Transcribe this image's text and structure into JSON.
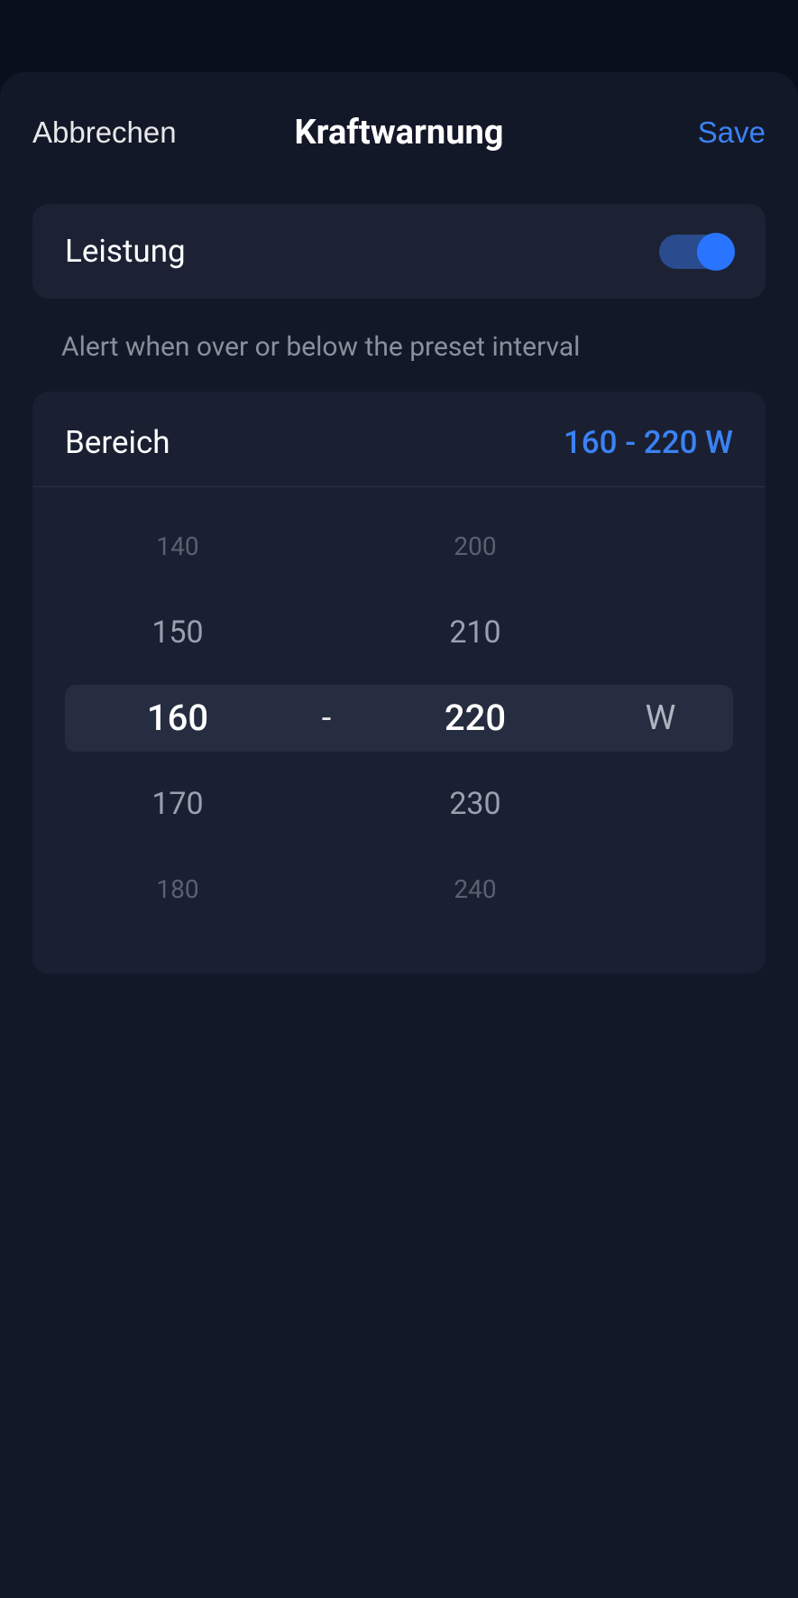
{
  "header": {
    "cancel": "Abbrechen",
    "title": "Kraftwarnung",
    "save": "Save"
  },
  "toggle": {
    "label": "Leistung",
    "enabled": true
  },
  "hint": "Alert when over or below the preset interval",
  "range": {
    "label": "Bereich",
    "display": "160 - 220 W",
    "separator": "-",
    "unit": "W",
    "min_selected": "160",
    "max_selected": "220",
    "min_options": [
      "140",
      "150",
      "160",
      "170",
      "180"
    ],
    "max_options": [
      "200",
      "210",
      "220",
      "230",
      "240"
    ]
  }
}
